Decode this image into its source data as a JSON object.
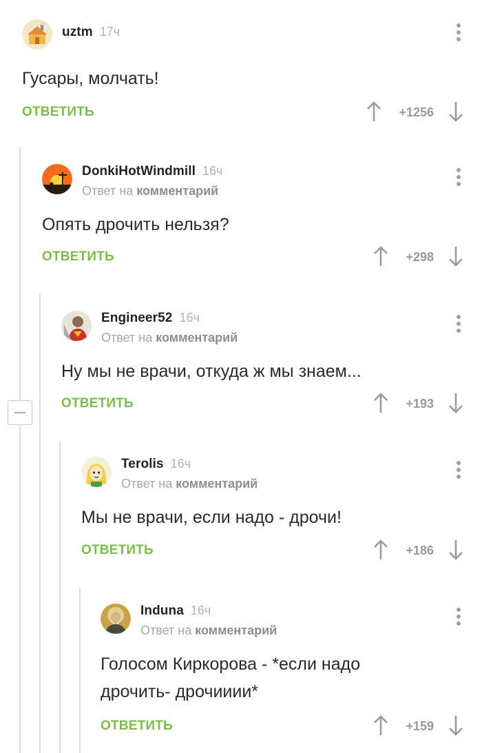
{
  "comments": [
    {
      "username": "uztm",
      "time": "17ч",
      "reply_to": null,
      "text_lines": [
        "Гусары, молчать!"
      ],
      "reply_label": "ОТВЕТИТЬ",
      "rating": "+1256",
      "avatar": "house-avatar"
    },
    {
      "username": "DonkiHotWindmill",
      "time": "16ч",
      "reply_prefix": "Ответ на",
      "reply_target": "комментарий",
      "text_lines": [
        "Опять дрочить нельзя?"
      ],
      "reply_label": "ОТВЕТИТЬ",
      "rating": "+298",
      "avatar": "sunset-windmill-avatar"
    },
    {
      "username": "Engineer52",
      "time": "16ч",
      "reply_prefix": "Ответ на",
      "reply_target": "комментарий",
      "text_lines": [
        "Ну мы не врачи, откуда ж мы знаем..."
      ],
      "reply_label": "ОТВЕТИТЬ",
      "rating": "+193",
      "avatar": "superhero-avatar"
    },
    {
      "username": "Terolis",
      "time": "16ч",
      "reply_prefix": "Ответ на",
      "reply_target": "комментарий",
      "text_lines": [
        "Мы не врачи, если надо - дрочи!"
      ],
      "reply_label": "ОТВЕТИТЬ",
      "rating": "+186",
      "avatar": "cartoon-girl-avatar"
    },
    {
      "username": "Induna",
      "time": "16ч",
      "reply_prefix": "Ответ на",
      "reply_target": "комментарий",
      "text_lines": [
        "Голосом Киркорова - *если надо",
        "дрочить- дрочииии*"
      ],
      "reply_label": "ОТВЕТИТЬ",
      "rating": "+159",
      "avatar": "icon-portrait-avatar"
    }
  ],
  "icons": {
    "upvote": "arrow-up-icon",
    "downvote": "arrow-down-icon",
    "menu": "more-vertical-icon",
    "collapse": "minus-icon"
  },
  "colors": {
    "reply_green": "#7cbb4e",
    "rating_gray": "#9a9a9a",
    "thread_line": "#dedede"
  }
}
